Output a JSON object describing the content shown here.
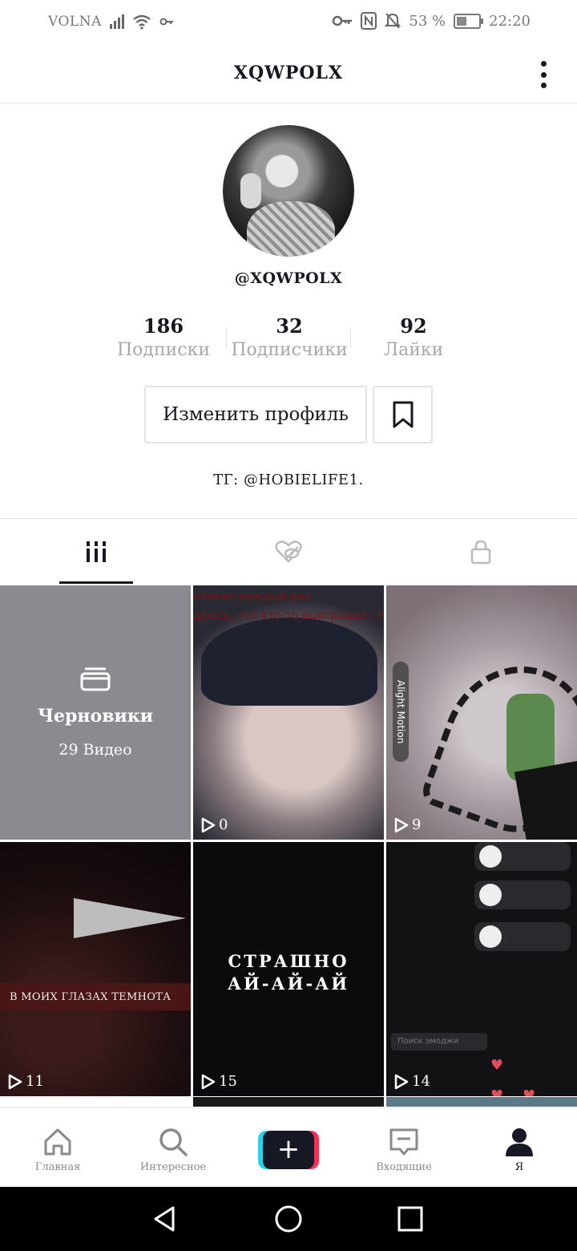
{
  "status_bar": {
    "carrier": "VOLNA",
    "battery_percent_text": "53 %",
    "battery_level": 0.53,
    "time": "22:20"
  },
  "header": {
    "title": "XQWPOLX"
  },
  "profile": {
    "username": "@XQWPOLX",
    "stats": [
      {
        "value": "186",
        "label": "Подписки"
      },
      {
        "value": "32",
        "label": "Подписчики"
      },
      {
        "value": "92",
        "label": "Лайки"
      }
    ],
    "edit_button_label": "Изменить профиль",
    "bio": "ТГ: @HOBIELIFE1."
  },
  "tabs": [
    "videos-grid-icon",
    "liked-hidden-icon",
    "private-lock-icon"
  ],
  "grid": {
    "drafts": {
      "title": "Черновики",
      "count": "29 Видео"
    },
    "videos": [
      {
        "views": "0",
        "overlay_text": [
          "плакал каждый раз",
          "деюсь, что кто-то выигрывает его"
        ]
      },
      {
        "views": "9",
        "watermark": "Alight Motion"
      },
      {
        "views": "11",
        "overlay_text": [
          "В МОИХ ГЛАЗАХ ТЕМНОТА"
        ]
      },
      {
        "views": "15",
        "overlay_text": [
          "СТРАШНО",
          "АЙ-АЙ-АЙ"
        ]
      },
      {
        "views": "14",
        "overlay_text": [
          "Поиск эмоджи"
        ]
      }
    ]
  },
  "bottom_nav": [
    {
      "label": "Главная",
      "icon": "home-icon"
    },
    {
      "label": "Интересное",
      "icon": "search-icon"
    },
    {
      "label": "",
      "icon": "plus-icon"
    },
    {
      "label": "Входящие",
      "icon": "inbox-icon"
    },
    {
      "label": "Я",
      "icon": "profile-icon"
    }
  ],
  "colors": {
    "text": "#161823",
    "muted": "#a8a8a8",
    "drafts_bg": "#8a8a90",
    "accent_cyan": "#20d5ec",
    "accent_red": "#fe2c55"
  }
}
